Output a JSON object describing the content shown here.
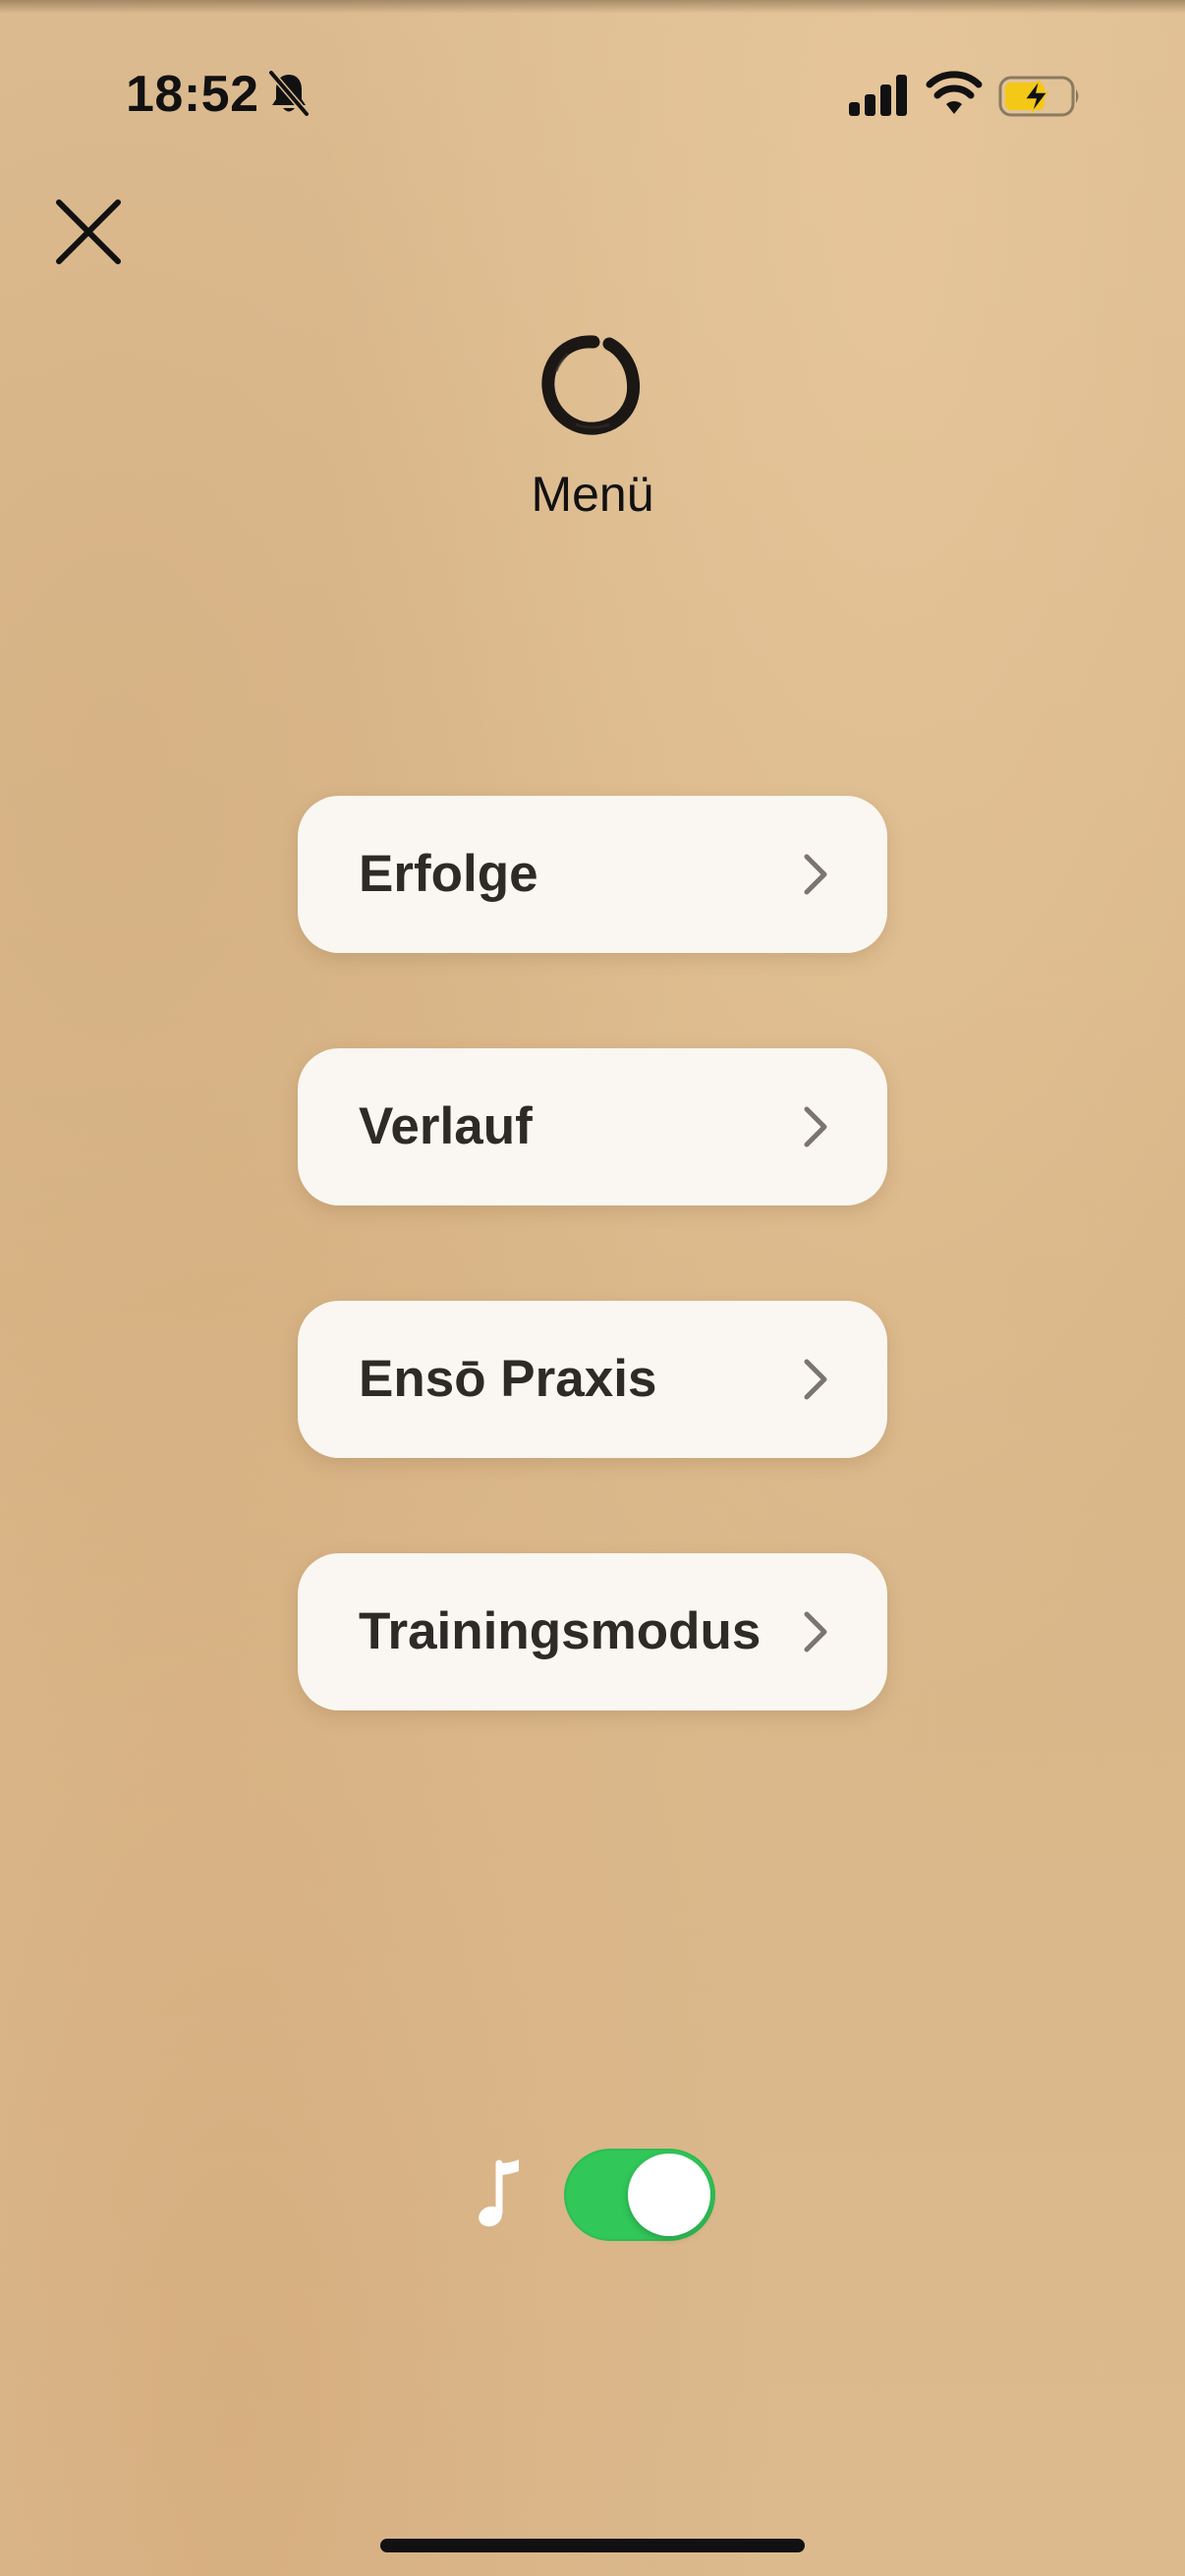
{
  "status_bar": {
    "time": "18:52",
    "icons": [
      "bell-slash-icon",
      "cellular-signal-icon",
      "wifi-icon",
      "battery-charging-icon"
    ],
    "battery_color": "#f4c816"
  },
  "header": {
    "close_icon": "close-icon",
    "logo_icon": "enso-circle-icon",
    "title": "Menü"
  },
  "menu": {
    "items": [
      {
        "label": "Erfolge"
      },
      {
        "label": "Verlauf"
      },
      {
        "label": "Ensō Praxis"
      },
      {
        "label": "Trainingsmodus"
      }
    ],
    "chevron_icon": "chevron-right-icon"
  },
  "footer": {
    "music_icon": "music-note-icon",
    "music_enabled": true,
    "toggle_color": "#31c759"
  }
}
